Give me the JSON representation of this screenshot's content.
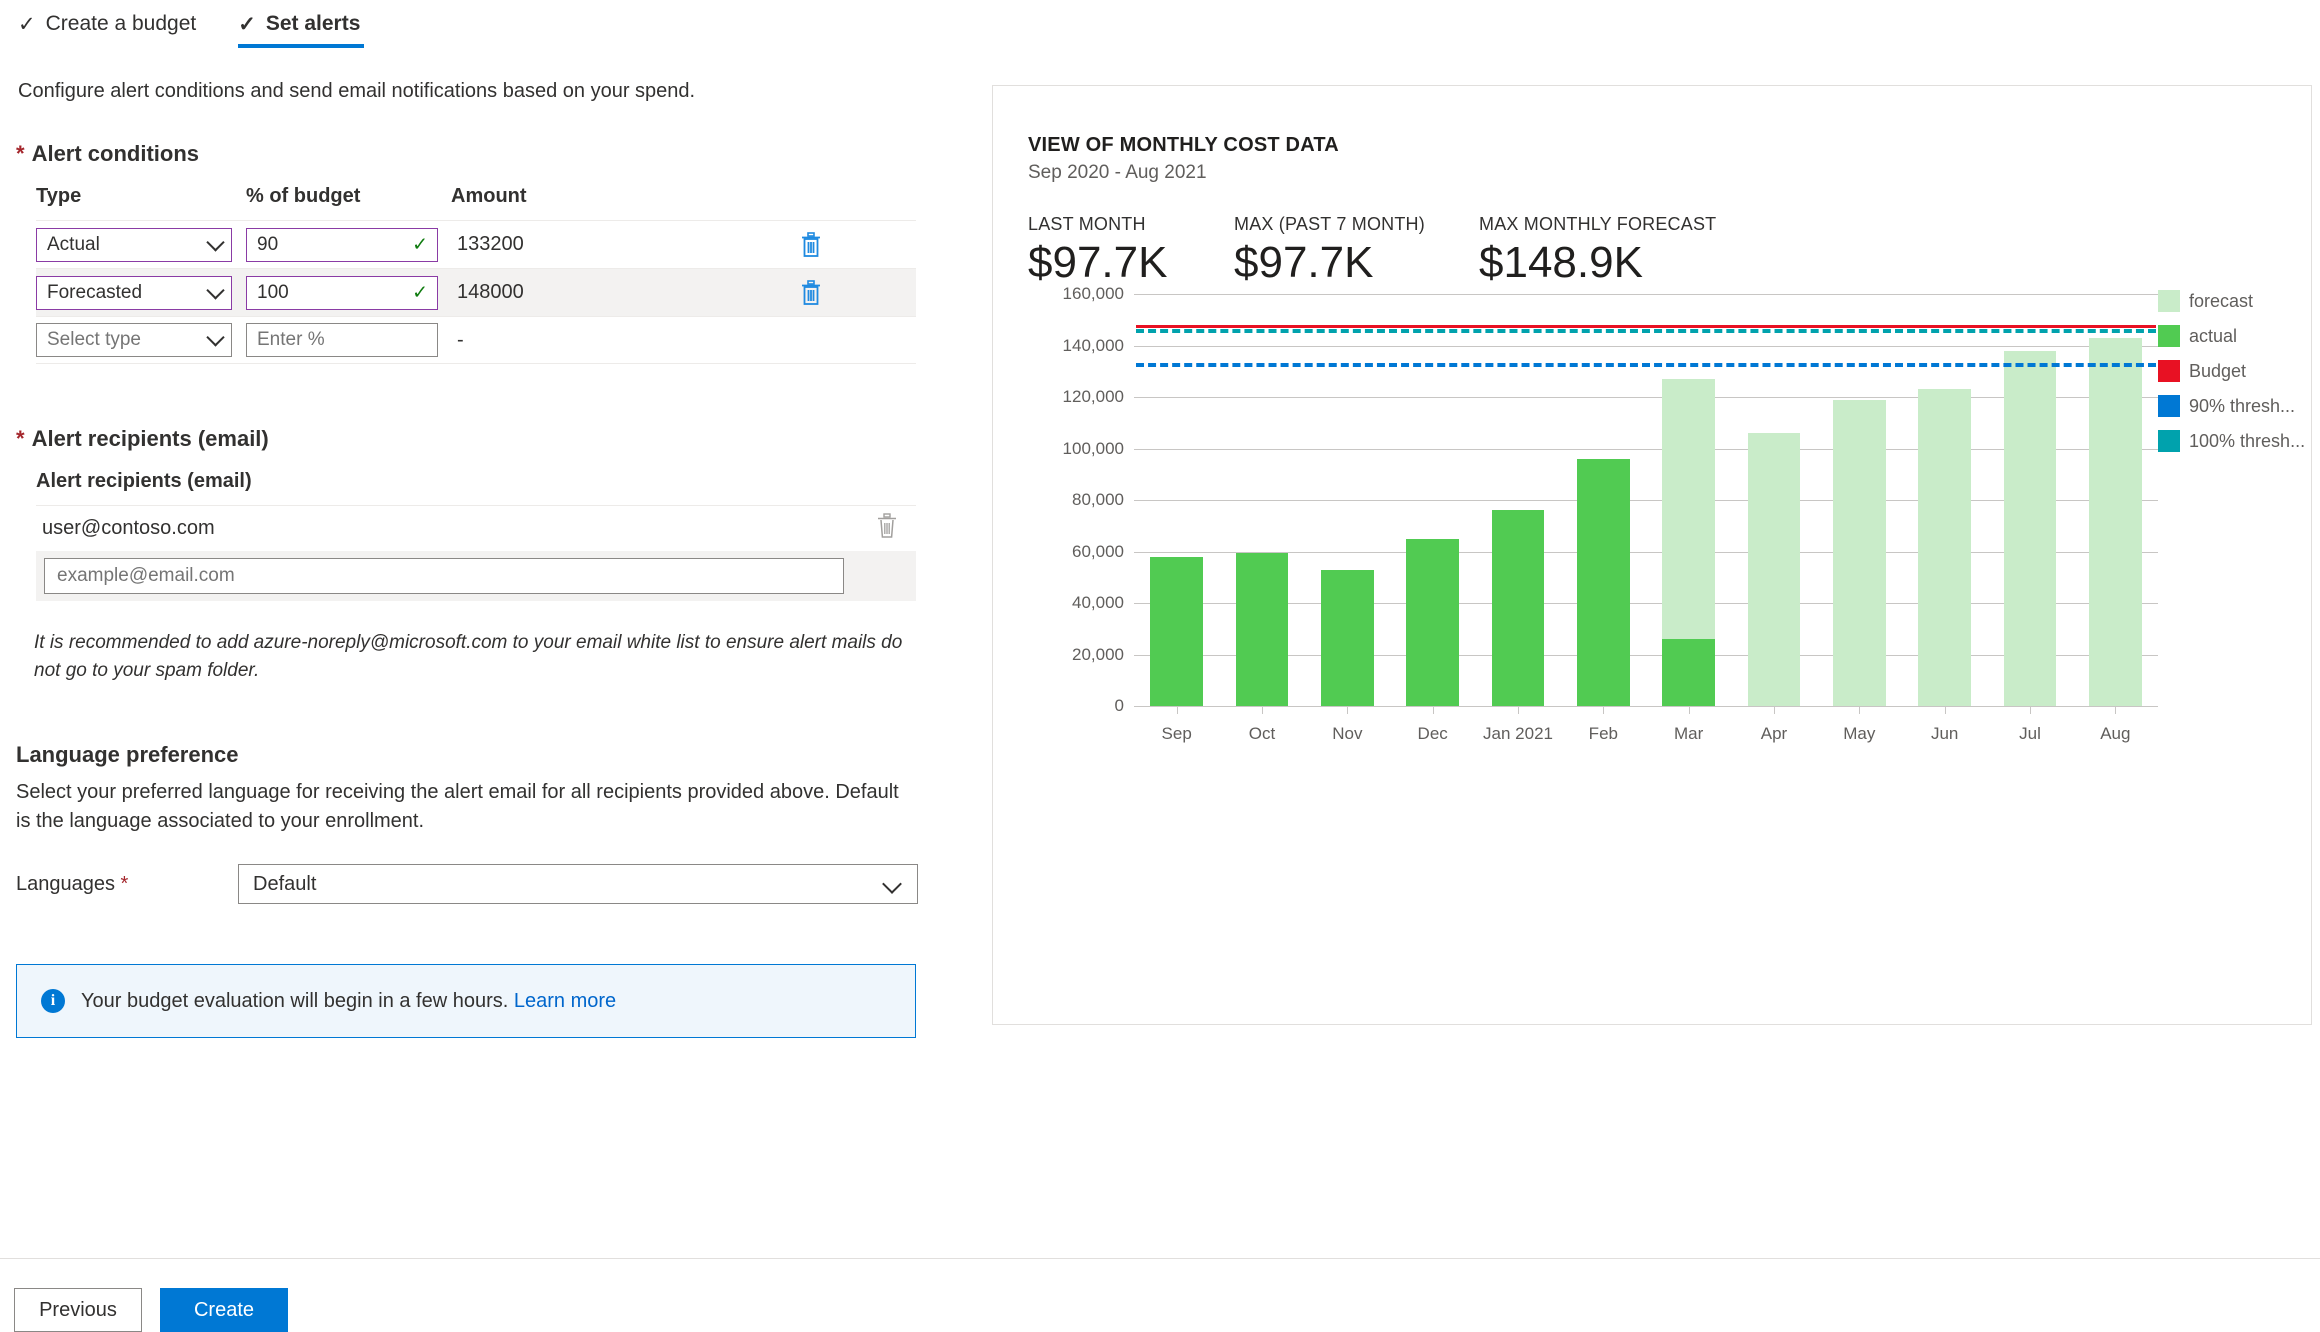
{
  "wizard": {
    "tabs": [
      {
        "label": "Create a budget",
        "icon": "check-icon",
        "active": false
      },
      {
        "label": "Set alerts",
        "icon": "check-icon",
        "active": true
      }
    ]
  },
  "intro": "Configure alert conditions and send email notifications based on your spend.",
  "alert_conditions": {
    "section_label": "Alert conditions",
    "required_marker": "*",
    "columns": [
      "Type",
      "% of budget",
      "Amount"
    ],
    "rows": [
      {
        "type": "Actual",
        "percent": "90",
        "amount": "133200",
        "delete_icon": "trash-icon",
        "filled": true
      },
      {
        "type": "Forecasted",
        "percent": "100",
        "amount": "148000",
        "delete_icon": "trash-icon",
        "filled": true
      },
      {
        "type": "Select type",
        "percent": "Enter %",
        "amount": "-",
        "delete_icon": "",
        "filled": false
      }
    ]
  },
  "alert_recipients": {
    "section_label": "Alert recipients (email)",
    "required_marker": "*",
    "column_header": "Alert recipients (email)",
    "existing": [
      {
        "email": "user@contoso.com",
        "delete_icon": "trash-icon"
      }
    ],
    "new_placeholder": "example@email.com",
    "note": "It is recommended to add azure-noreply@microsoft.com to your email white list to ensure alert mails do not go to your spam folder."
  },
  "language_preference": {
    "title": "Language preference",
    "description": "Select your preferred language for receiving the alert email for all recipients provided above. Default is the language associated to your enrollment.",
    "field_label": "Languages",
    "required_marker": "*",
    "selected": "Default"
  },
  "banner": {
    "icon": "info-icon",
    "text": "Your budget evaluation will begin in a few hours.",
    "link": "Learn more"
  },
  "footer": {
    "previous_label": "Previous",
    "create_label": "Create"
  },
  "chart_panel": {
    "title": "VIEW OF MONTHLY COST DATA",
    "subtitle": "Sep 2020 - Aug 2021",
    "kpis": [
      {
        "label": "LAST MONTH",
        "value": "$97.7K"
      },
      {
        "label": "MAX (PAST 7 MONTH)",
        "value": "$97.7K"
      },
      {
        "label": "MAX MONTHLY FORECAST",
        "value": "$148.9K"
      }
    ]
  },
  "chart_data": {
    "type": "bar",
    "title": "VIEW OF MONTHLY COST DATA",
    "subtitle": "Sep 2020 - Aug 2021",
    "xlabel": "",
    "ylabel": "",
    "ylim": [
      0,
      160000
    ],
    "yticks": [
      0,
      20000,
      40000,
      60000,
      80000,
      100000,
      120000,
      140000,
      160000
    ],
    "ytick_labels": [
      "0",
      "20,000",
      "40,000",
      "60,000",
      "80,000",
      "100,000",
      "120,000",
      "140,000",
      "160,000"
    ],
    "grid": true,
    "legend_position": "right",
    "categories": [
      "Sep",
      "Oct",
      "Nov",
      "Dec",
      "Jan 2021",
      "Feb",
      "Mar",
      "Apr",
      "May",
      "Jun",
      "Jul",
      "Aug"
    ],
    "series": [
      {
        "name": "actual",
        "color": "#51cb52",
        "values": [
          58000,
          59500,
          53000,
          65000,
          76000,
          96000,
          26000,
          0,
          0,
          0,
          0,
          0
        ]
      },
      {
        "name": "forecast",
        "color": "#c9ecc9",
        "values": [
          0,
          0,
          0,
          0,
          0,
          0,
          101000,
          106000,
          119000,
          123000,
          138000,
          143000
        ]
      }
    ],
    "reference_lines": [
      {
        "name": "Budget",
        "value": 148000,
        "color": "#e81123",
        "style": "solid"
      },
      {
        "name": "100% threshold",
        "value": 146500,
        "color": "#00a2ad",
        "style": "dashed"
      },
      {
        "name": "90% threshold",
        "value": 133200,
        "color": "#0078d4",
        "style": "dashed"
      }
    ],
    "legend": [
      {
        "label": "forecast",
        "color": "#c9ecc9"
      },
      {
        "label": "actual",
        "color": "#51cb52"
      },
      {
        "label": "Budget",
        "color": "#e81123"
      },
      {
        "label": "90% thresh...",
        "color": "#0078d4"
      },
      {
        "label": "100% thresh...",
        "color": "#00a2ad"
      }
    ]
  }
}
